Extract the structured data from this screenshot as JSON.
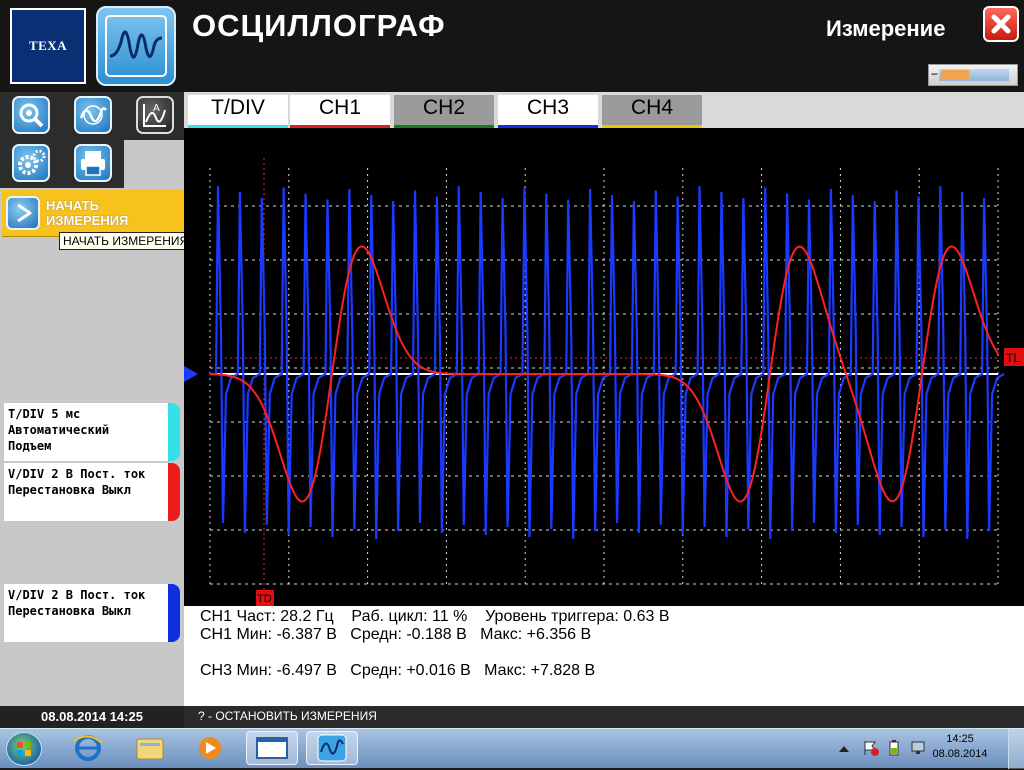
{
  "header": {
    "brand": "TEXA",
    "app_title": "ОСЦИЛЛОГРАФ",
    "mode": "Измерение",
    "progress_fraction": 0.4
  },
  "toolbar": {
    "icons": [
      "zoom-icon",
      "auto-tune-icon",
      "measure-graph-icon",
      "settings-gears-icon",
      "printer-icon"
    ]
  },
  "start_button": {
    "label": "НАЧАТЬ ИЗМЕРЕНИЯ",
    "tooltip": "НАЧАТЬ ИЗМЕРЕНИЯ"
  },
  "channel_cards": [
    {
      "line1": "T/DIV  5 мс",
      "line2": "Автоматический",
      "line3": "Подъем",
      "color": "#34e0e8"
    },
    {
      "line1": "V/DIV  2 В  Пост. ток",
      "line2": "Перестановка  Выкл",
      "line3": "",
      "color": "#ee1c1c"
    },
    {
      "line1": "V/DIV  2 В  Пост. ток",
      "line2": "Перестановка  Выкл",
      "line3": "",
      "color": "#1030e0"
    }
  ],
  "tabs": [
    {
      "label": "T/DIV",
      "color": "#34e0e8",
      "bg": "#ffffff"
    },
    {
      "label": "CH1",
      "color": "#e02020",
      "bg": "#ffffff"
    },
    {
      "label": "CH2",
      "color": "#1a7a1a",
      "bg": "#9a9a9a"
    },
    {
      "label": "CH3",
      "color": "#1030e0",
      "bg": "#ffffff"
    },
    {
      "label": "CH4",
      "color": "#e8c800",
      "bg": "#9a9a9a"
    }
  ],
  "scope": {
    "trigger_level_marker": "TL",
    "trigger_delay_marker": "TD",
    "ch1_color": "#ff2020",
    "ch3_color": "#1a3aff",
    "ch3_pulse_count": 36
  },
  "readout": {
    "line1": "CH1 Част: 28.2 Гц    Раб. цикл: 11 %    Уровень триггера: 0.63 В",
    "line2": "CH1 Мин: -6.387 В   Средн: -0.188 В   Макс: +6.356 В",
    "line3": "CH3 Мин: -6.497 В   Средн: +0.016 В   Макс: +7.828 В"
  },
  "status": {
    "datetime": "08.08.2014  14:25",
    "hint": "? - ОСТАНОВИТЬ ИЗМЕРЕНИЯ"
  },
  "taskbar": {
    "time": "14:25",
    "date": "08.08.2014",
    "apps": [
      "internet-explorer-icon",
      "file-explorer-icon",
      "media-player-icon",
      "window-icon",
      "oscilloscope-app-icon"
    ]
  }
}
